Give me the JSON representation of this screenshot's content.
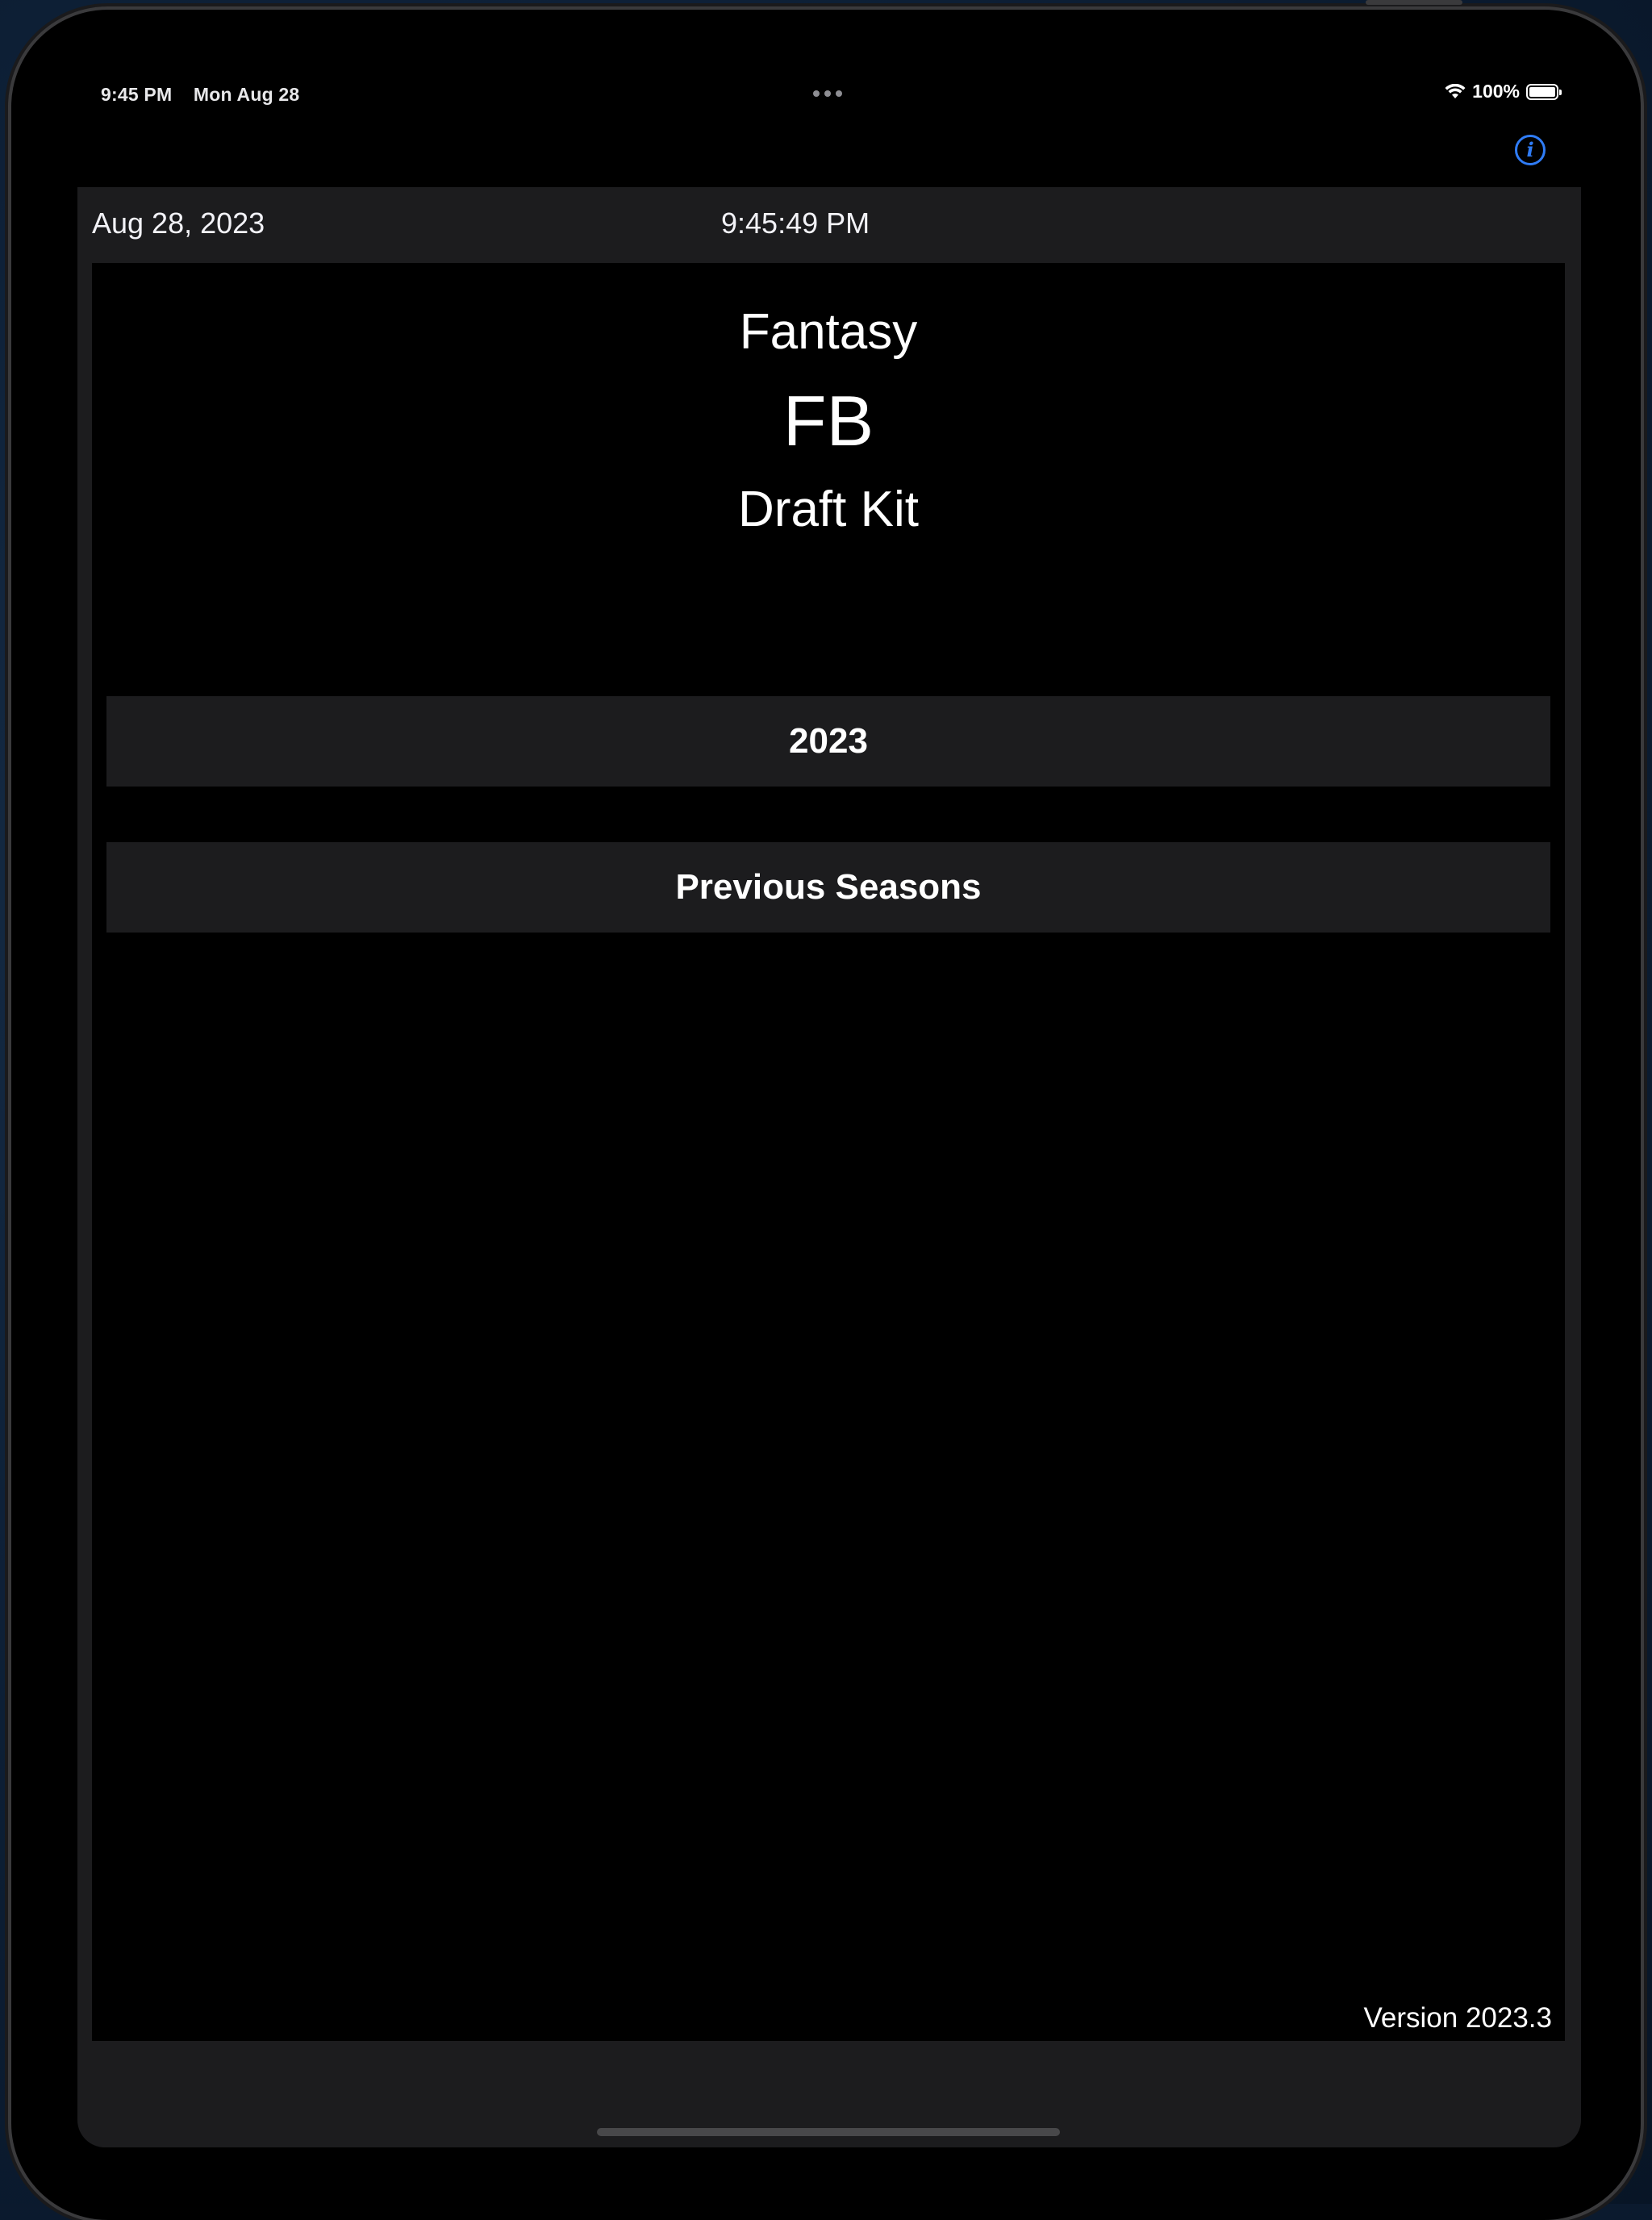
{
  "status_bar": {
    "time": "9:45 PM",
    "date": "Mon Aug 28",
    "battery": "100%"
  },
  "header": {
    "info_icon": "info-circle-icon",
    "accent_color": "#2f7cf6"
  },
  "date_strip": {
    "date": "Aug 28, 2023",
    "time": "9:45:49 PM"
  },
  "title": {
    "line1": "Fantasy",
    "line2": "FB",
    "line3": "Draft Kit"
  },
  "buttons": {
    "current_season": "2023",
    "previous_seasons": "Previous Seasons"
  },
  "footer": {
    "version": "Version 2023.3"
  }
}
